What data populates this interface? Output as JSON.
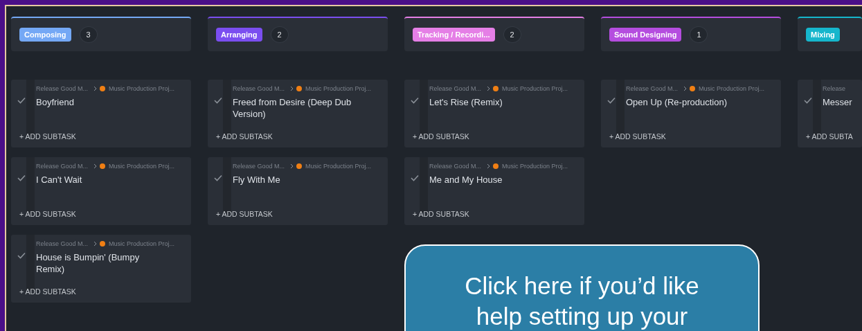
{
  "columns": [
    {
      "status": "Composing",
      "color": "#74a8f5",
      "count": "3",
      "cards": [
        {
          "parent": "Release Good M...",
          "project": "Music Production Proj...",
          "title": "Boyfriend",
          "action": "+ ADD SUBTASK"
        },
        {
          "parent": "Release Good M...",
          "project": "Music Production Proj...",
          "title": "I Can't Wait",
          "action": "+ ADD SUBTASK"
        },
        {
          "parent": "Release Good M...",
          "project": "Music Production Proj...",
          "title": "House is Bumpin' (Bumpy Remix)",
          "action": "+ ADD SUBTASK"
        }
      ]
    },
    {
      "status": "Arranging",
      "color": "#7b4ef0",
      "count": "2",
      "cards": [
        {
          "parent": "Release Good M...",
          "project": "Music Production Proj...",
          "title": "Freed from Desire (Deep Dub Version)",
          "action": "+ ADD SUBTASK"
        },
        {
          "parent": "Release Good M...",
          "project": "Music Production Proj...",
          "title": "Fly With Me",
          "action": "+ ADD SUBTASK"
        }
      ]
    },
    {
      "status": "Tracking / Recordi...",
      "color": "#e57fe6",
      "count": "2",
      "cards": [
        {
          "parent": "Release Good M...",
          "project": "Music Production Proj...",
          "title": "Let's Rise (Remix)",
          "action": "+ ADD SUBTASK"
        },
        {
          "parent": "Release Good M...",
          "project": "Music Production Proj...",
          "title": "Me and My House",
          "action": "+ ADD SUBTASK"
        }
      ]
    },
    {
      "status": "Sound Designing",
      "color": "#b54ddf",
      "count": "1",
      "cards": [
        {
          "parent": "Release Good M...",
          "project": "Music Production Proj...",
          "title": "Open Up (Re-production)",
          "action": "+ ADD SUBTASK"
        }
      ]
    },
    {
      "status": "Mixing",
      "color": "#16b6cc",
      "cards": [
        {
          "parent": "Release",
          "title": "Messer",
          "action": "+ ADD SUBTA"
        }
      ]
    }
  ],
  "help_callout": {
    "lines": [
      "Click here if you’d like",
      "help setting up your"
    ]
  }
}
